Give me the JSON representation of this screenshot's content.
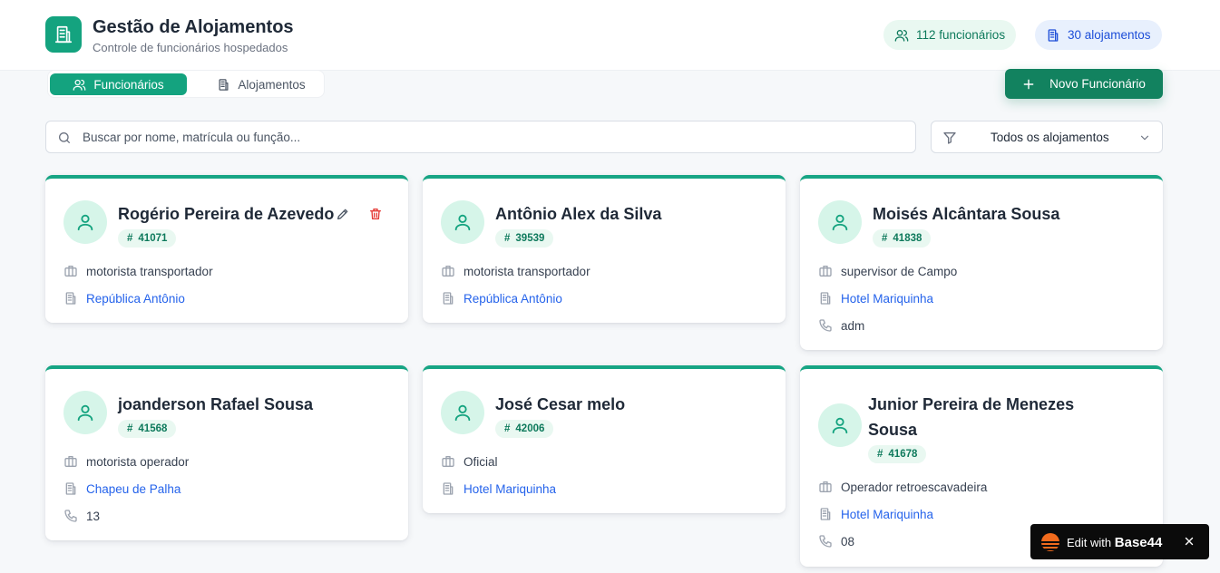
{
  "header": {
    "title": "Gestão de Alojamentos",
    "subtitle": "Controle de funcionários hospedados",
    "stats": {
      "employees": "112 funcionários",
      "housings": "30 alojamentos"
    }
  },
  "tabs": {
    "employees": "Funcionários",
    "housings": "Alojamentos"
  },
  "actions": {
    "new_employee": "Novo Funcionário"
  },
  "search": {
    "placeholder": "Buscar por nome, matrícula ou função..."
  },
  "filter": {
    "selected": "Todos os alojamentos"
  },
  "employees": [
    {
      "name": "Rogério Pereira de Azevedo",
      "id": "41071",
      "role": "motorista transportador",
      "housing": "República Antônio"
    },
    {
      "name": "Antônio Alex da Silva",
      "id": "39539",
      "role": "motorista transportador",
      "housing": "República Antônio"
    },
    {
      "name": "Moisés Alcântara Sousa",
      "id": "41838",
      "role": "supervisor de Campo",
      "housing": "Hotel Mariquinha",
      "phone": "adm"
    },
    {
      "name": "joanderson Rafael Sousa",
      "id": "41568",
      "role": "motorista operador",
      "housing": "Chapeu de Palha",
      "phone": "13"
    },
    {
      "name": "José Cesar melo",
      "id": "42006",
      "role": "Oficial",
      "housing": "Hotel Mariquinha"
    },
    {
      "name": "Junior Pereira de Menezes Sousa",
      "id": "41678",
      "role": "Operador retroescavadeira",
      "housing": "Hotel Mariquinha",
      "phone": "08"
    }
  ],
  "base44": {
    "prefix": "Edit with",
    "brand": "Base44"
  },
  "colors": {
    "primary": "#14a37f",
    "primary_dark": "#12825f",
    "link": "#2563eb",
    "danger": "#e53935"
  }
}
